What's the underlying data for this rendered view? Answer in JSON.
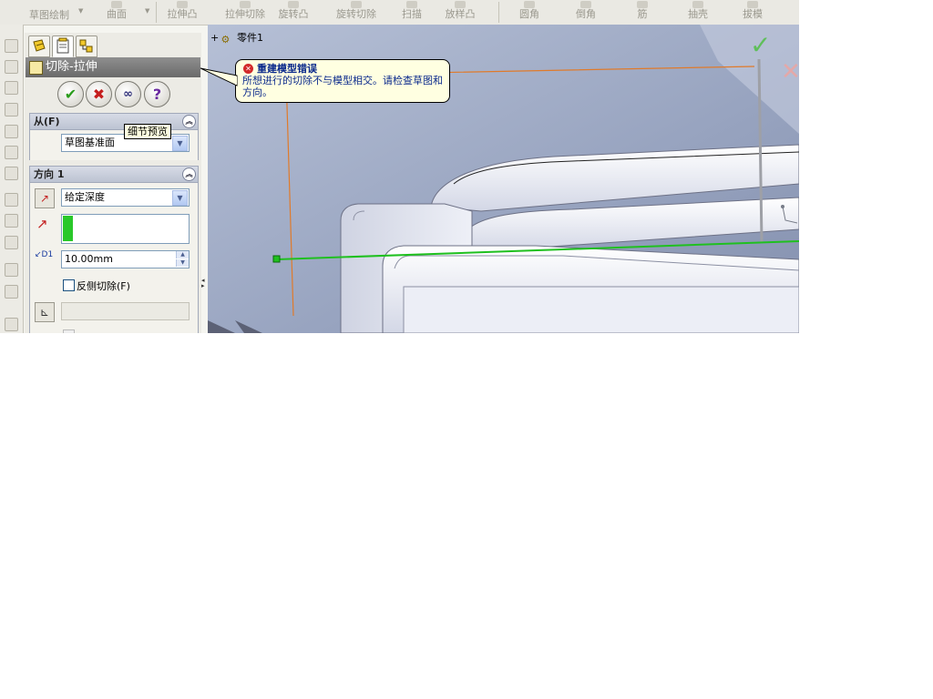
{
  "toolbar": {
    "buttons": [
      {
        "label": "草图绘制"
      },
      {
        "label": "曲面"
      },
      {
        "label": "拉伸凸"
      },
      {
        "label": "拉伸切除"
      },
      {
        "label": "旋转凸"
      },
      {
        "label": "旋转切除"
      },
      {
        "label": "扫描"
      },
      {
        "label": "放样凸"
      },
      {
        "label": "圆角"
      },
      {
        "label": "倒角"
      },
      {
        "label": "筋"
      },
      {
        "label": "抽壳"
      },
      {
        "label": "拔模"
      }
    ]
  },
  "property_manager": {
    "tabs": [
      {
        "icon": "feature-manager-icon"
      },
      {
        "icon": "property-manager-icon"
      },
      {
        "icon": "configuration-manager-icon"
      }
    ],
    "title": "切除-拉伸",
    "actions": {
      "ok": "✔",
      "cancel": "✖",
      "detail": "∞",
      "help": "?"
    },
    "tooltip": "细节预览",
    "from_group": {
      "label": "从(F)",
      "selected": "草图基准面"
    },
    "direction_group": {
      "label": "方向 1",
      "end_condition": "给定深度",
      "depth": "10.00mm",
      "flip_side_cut": "反侧切除(F)",
      "flip_side_cut_checked": false
    }
  },
  "graphics": {
    "tree_node": "零件1",
    "error_balloon": {
      "title": "重建模型错误",
      "message": "所想进行的切除不与模型相交。请检查草图和方向。"
    },
    "colors": {
      "background": "#9aa6c2",
      "model": "#eef0f8",
      "sketch_line": "#1fc01f",
      "plane": "#e07a2a"
    }
  }
}
